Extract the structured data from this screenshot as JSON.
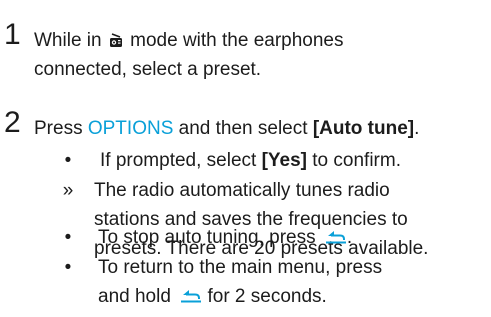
{
  "cut_top_text": "",
  "steps": [
    {
      "number": "1",
      "line1_a": "While in",
      "line1_b": "mode with the earphones",
      "line2": "connected, select a preset."
    },
    {
      "number": "2",
      "press": "Press",
      "options": "OPTIONS",
      "and_then": "and then select",
      "auto_tune": "[Auto tune]",
      "end": "."
    }
  ],
  "sub_items": {
    "prompt_a": "If prompted, select",
    "prompt_yes": "[Yes]",
    "prompt_b": "to confirm.",
    "result_marker": "»",
    "result_line1": "The radio automatically tunes radio",
    "result_line2": "stations and saves the frequencies to",
    "result_line3": "presets. There are 20 presets available.",
    "stop_a": "To stop auto tuning, press",
    "stop_end": ".",
    "return_line1": "To return to the main menu, press",
    "return_line2_a": "and hold",
    "return_line2_b": "for 2 seconds.",
    "bullet": "•"
  },
  "icons": {
    "radio_mode": "radio-mode-icon",
    "back": "back-arrow-icon"
  },
  "colors": {
    "accent": "#0aa0d8",
    "text": "#1c1c1c"
  }
}
